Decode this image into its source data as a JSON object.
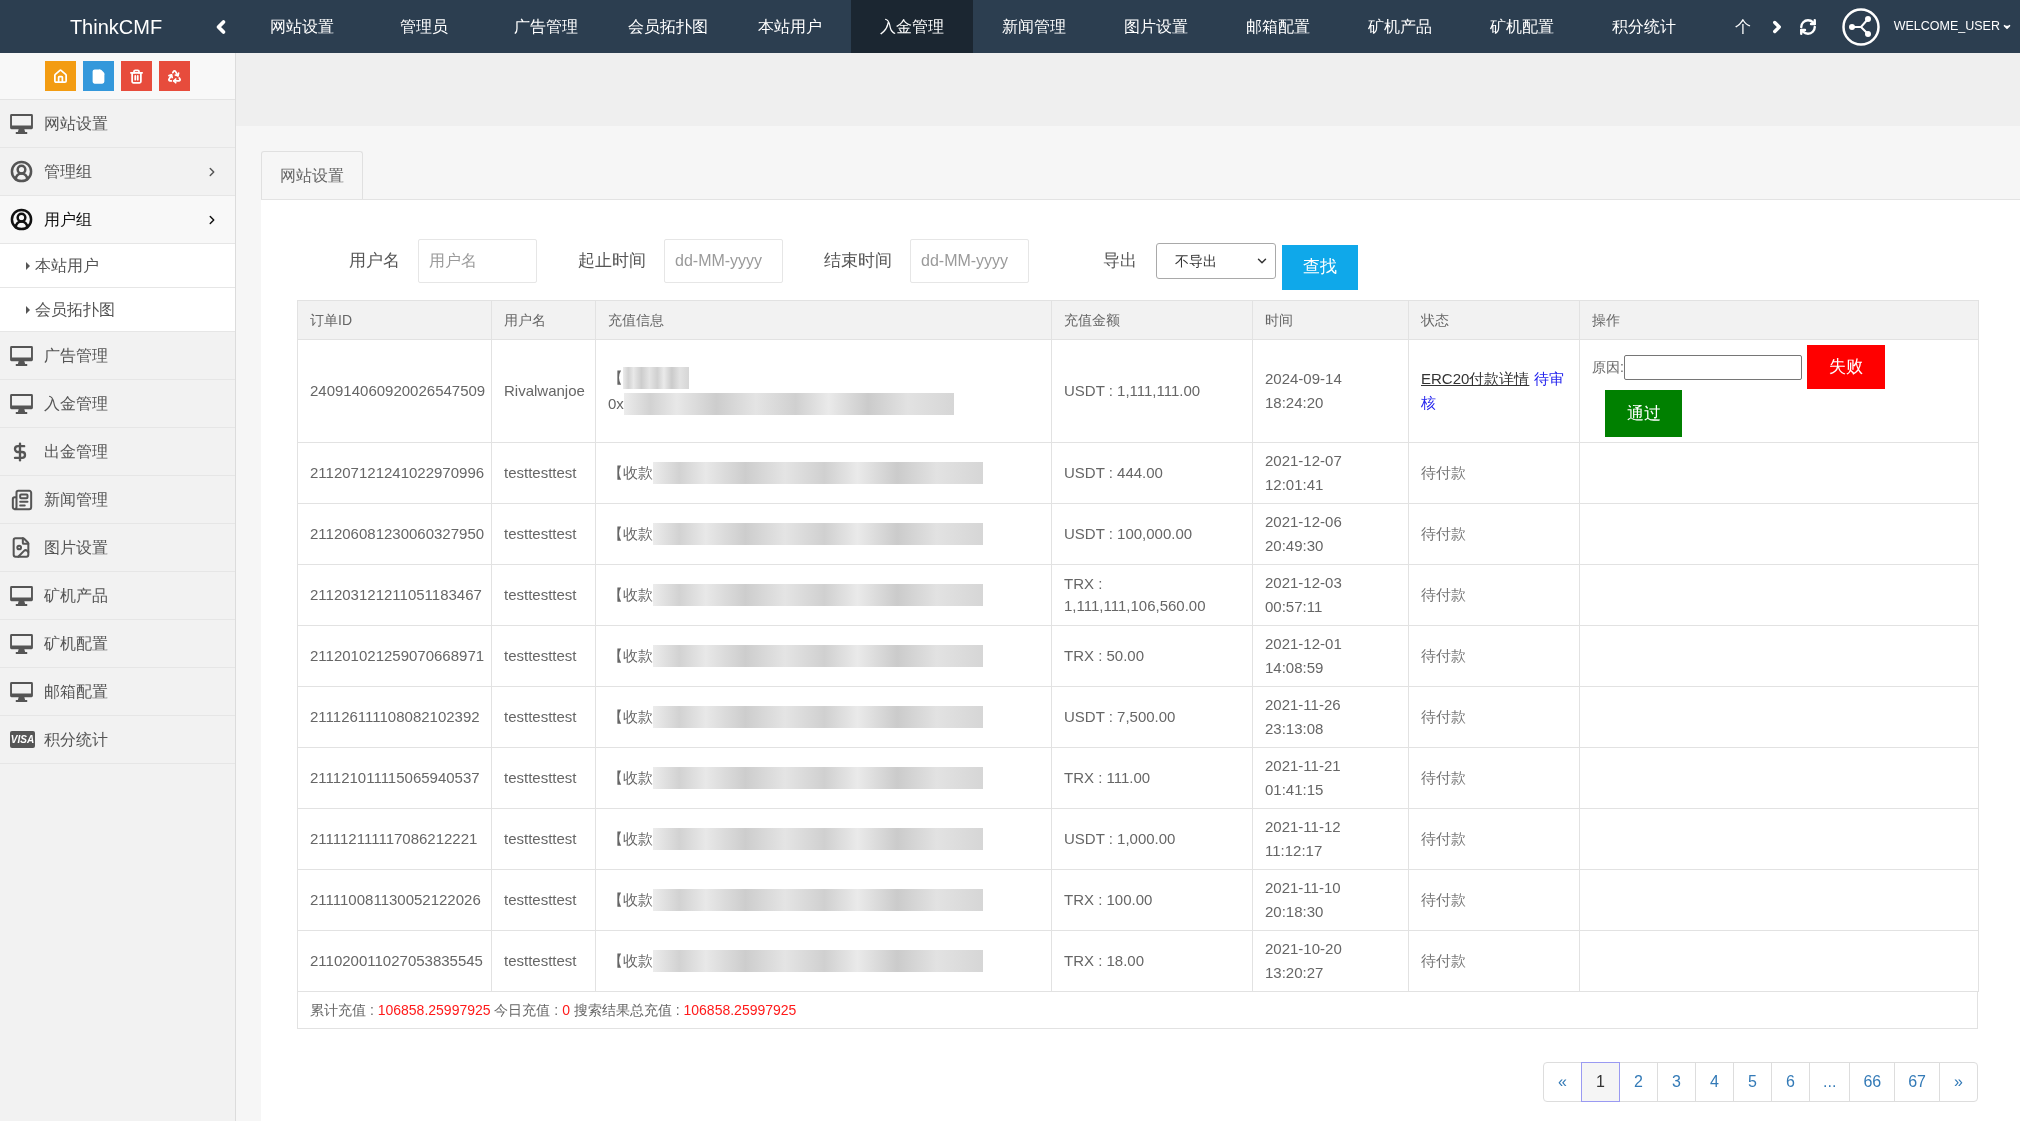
{
  "topbar": {
    "brand": "ThinkCMF",
    "nav": [
      {
        "label": "网站设置",
        "selected": false
      },
      {
        "label": "管理员",
        "selected": false
      },
      {
        "label": "广告管理",
        "selected": false
      },
      {
        "label": "会员拓扑图",
        "selected": false
      },
      {
        "label": "本站用户",
        "selected": false
      },
      {
        "label": "入金管理",
        "selected": true
      },
      {
        "label": "新闻管理",
        "selected": false
      },
      {
        "label": "图片设置",
        "selected": false
      },
      {
        "label": "邮箱配置",
        "selected": false
      },
      {
        "label": "矿机产品",
        "selected": false
      },
      {
        "label": "矿机配置",
        "selected": false
      },
      {
        "label": "积分统计",
        "selected": false
      },
      {
        "label": "个",
        "selected": false
      }
    ],
    "user": "WELCOME_USER"
  },
  "sidebar": {
    "quick_buttons": [
      {
        "kind": "home"
      },
      {
        "kind": "file"
      },
      {
        "kind": "trash"
      },
      {
        "kind": "recycle"
      }
    ],
    "items": [
      {
        "label": "网站设置",
        "kind": "monitor"
      },
      {
        "label": "管理组",
        "kind": "user",
        "expanded": false
      },
      {
        "label": "用户组",
        "kind": "user",
        "expanded": true,
        "children": [
          {
            "label": "本站用户"
          },
          {
            "label": "会员拓扑图"
          }
        ]
      },
      {
        "label": "广告管理",
        "kind": "monitor"
      },
      {
        "label": "入金管理",
        "kind": "monitor"
      },
      {
        "label": "出金管理",
        "kind": "dollar"
      },
      {
        "label": "新闻管理",
        "kind": "news"
      },
      {
        "label": "图片设置",
        "kind": "image"
      },
      {
        "label": "矿机产品",
        "kind": "monitor"
      },
      {
        "label": "矿机配置",
        "kind": "monitor"
      },
      {
        "label": "邮箱配置",
        "kind": "monitor"
      },
      {
        "label": "积分统计",
        "kind": "card",
        "badge": "VISA"
      }
    ]
  },
  "tabs": [
    {
      "label": "网站设置",
      "selected": true
    }
  ],
  "filters": {
    "fields": [
      {
        "label": "用户名",
        "placeholder": "用户名"
      },
      {
        "label": "起止时间",
        "placeholder": "dd-MM-yyyy"
      },
      {
        "label": "结束时间",
        "placeholder": "dd-MM-yyyy"
      }
    ],
    "export": {
      "label": "导出",
      "value": "不导出"
    },
    "search_button": "查找"
  },
  "table": {
    "columns": [
      "订单ID",
      "用户名",
      "充值信息",
      "充值金额",
      "时间",
      "状态",
      "操作"
    ],
    "rows": [
      {
        "order_id": "240914060920026547509",
        "username": "Rivalwanjoe",
        "info": [
          "【",
          "0x"
        ],
        "amount": "USDT : 1,111,111.00",
        "time": "2024-09-14 18:24:20",
        "status": {
          "kind": "review",
          "link": "ERC20付款详情",
          "text": "待审核"
        },
        "actions": {
          "reason_label": "原因:",
          "reject": "失败",
          "approve": "通过"
        }
      },
      {
        "order_id": "211207121241022970996",
        "username": "testtesttest",
        "info": [
          "【收款"
        ],
        "amount": "USDT : 444.00",
        "time": "2021-12-07 12:01:41",
        "status": {
          "kind": "pending",
          "text": "待付款"
        }
      },
      {
        "order_id": "211206081230060327950",
        "username": "testtesttest",
        "info": [
          "【收款"
        ],
        "amount": "USDT : 100,000.00",
        "time": "2021-12-06 20:49:30",
        "status": {
          "kind": "pending",
          "text": "待付款"
        }
      },
      {
        "order_id": "211203121211051183467",
        "username": "testtesttest",
        "info": [
          "【收款"
        ],
        "amount": "TRX : 1,111,111,106,560.00",
        "time": "2021-12-03 00:57:11",
        "status": {
          "kind": "pending",
          "text": "待付款"
        }
      },
      {
        "order_id": "211201021259070668971",
        "username": "testtesttest",
        "info": [
          "【收款"
        ],
        "amount": "TRX : 50.00",
        "time": "2021-12-01 14:08:59",
        "status": {
          "kind": "pending",
          "text": "待付款"
        }
      },
      {
        "order_id": "211126111108082102392",
        "username": "testtesttest",
        "info": [
          "【收款"
        ],
        "amount": "USDT : 7,500.00",
        "time": "2021-11-26 23:13:08",
        "status": {
          "kind": "pending",
          "text": "待付款"
        }
      },
      {
        "order_id": "211121011115065940537",
        "username": "testtesttest",
        "info": [
          "【收款"
        ],
        "amount": "TRX : 111.00",
        "time": "2021-11-21 01:41:15",
        "status": {
          "kind": "pending",
          "text": "待付款"
        }
      },
      {
        "order_id": "211112111117086212221",
        "username": "testtesttest",
        "info": [
          "【收款"
        ],
        "amount": "USDT : 1,000.00",
        "time": "2021-11-12 11:12:17",
        "status": {
          "kind": "pending",
          "text": "待付款"
        }
      },
      {
        "order_id": "211110081130052122026",
        "username": "testtesttest",
        "info": [
          "【收款"
        ],
        "amount": "TRX : 100.00",
        "time": "2021-11-10 20:18:30",
        "status": {
          "kind": "pending",
          "text": "待付款"
        }
      },
      {
        "order_id": "211020011027053835545",
        "username": "testtesttest",
        "info": [
          "【收款"
        ],
        "amount": "TRX : 18.00",
        "time": "2021-10-20 13:20:27",
        "status": {
          "kind": "pending",
          "text": "待付款"
        }
      }
    ]
  },
  "summary": [
    {
      "label": "累计充值 : ",
      "value": "106858.25997925"
    },
    {
      "label": "今日充值 : ",
      "value": "0"
    },
    {
      "label": "搜索结果总充值 : ",
      "value": "106858.25997925"
    }
  ],
  "pagination": [
    {
      "label": "«",
      "selected": false
    },
    {
      "label": "1",
      "selected": true
    },
    {
      "label": "2",
      "selected": false
    },
    {
      "label": "3",
      "selected": false
    },
    {
      "label": "4",
      "selected": false
    },
    {
      "label": "5",
      "selected": false
    },
    {
      "label": "6",
      "selected": false
    },
    {
      "label": "...",
      "selected": false
    },
    {
      "label": "66",
      "selected": false
    },
    {
      "label": "67",
      "selected": false
    },
    {
      "label": "»",
      "selected": false
    }
  ]
}
